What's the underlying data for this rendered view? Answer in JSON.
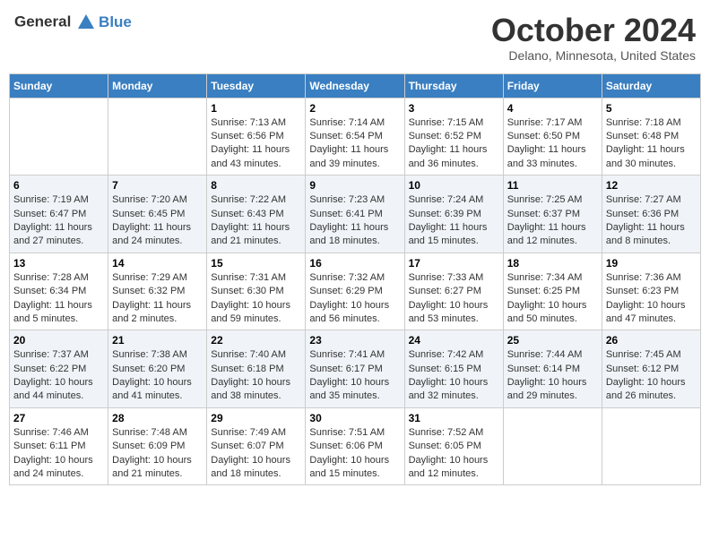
{
  "header": {
    "logo_line1": "General",
    "logo_line2": "Blue",
    "month": "October 2024",
    "location": "Delano, Minnesota, United States"
  },
  "weekdays": [
    "Sunday",
    "Monday",
    "Tuesday",
    "Wednesday",
    "Thursday",
    "Friday",
    "Saturday"
  ],
  "weeks": [
    [
      {
        "day": "",
        "sunrise": "",
        "sunset": "",
        "daylight": ""
      },
      {
        "day": "",
        "sunrise": "",
        "sunset": "",
        "daylight": ""
      },
      {
        "day": "1",
        "sunrise": "Sunrise: 7:13 AM",
        "sunset": "Sunset: 6:56 PM",
        "daylight": "Daylight: 11 hours and 43 minutes."
      },
      {
        "day": "2",
        "sunrise": "Sunrise: 7:14 AM",
        "sunset": "Sunset: 6:54 PM",
        "daylight": "Daylight: 11 hours and 39 minutes."
      },
      {
        "day": "3",
        "sunrise": "Sunrise: 7:15 AM",
        "sunset": "Sunset: 6:52 PM",
        "daylight": "Daylight: 11 hours and 36 minutes."
      },
      {
        "day": "4",
        "sunrise": "Sunrise: 7:17 AM",
        "sunset": "Sunset: 6:50 PM",
        "daylight": "Daylight: 11 hours and 33 minutes."
      },
      {
        "day": "5",
        "sunrise": "Sunrise: 7:18 AM",
        "sunset": "Sunset: 6:48 PM",
        "daylight": "Daylight: 11 hours and 30 minutes."
      }
    ],
    [
      {
        "day": "6",
        "sunrise": "Sunrise: 7:19 AM",
        "sunset": "Sunset: 6:47 PM",
        "daylight": "Daylight: 11 hours and 27 minutes."
      },
      {
        "day": "7",
        "sunrise": "Sunrise: 7:20 AM",
        "sunset": "Sunset: 6:45 PM",
        "daylight": "Daylight: 11 hours and 24 minutes."
      },
      {
        "day": "8",
        "sunrise": "Sunrise: 7:22 AM",
        "sunset": "Sunset: 6:43 PM",
        "daylight": "Daylight: 11 hours and 21 minutes."
      },
      {
        "day": "9",
        "sunrise": "Sunrise: 7:23 AM",
        "sunset": "Sunset: 6:41 PM",
        "daylight": "Daylight: 11 hours and 18 minutes."
      },
      {
        "day": "10",
        "sunrise": "Sunrise: 7:24 AM",
        "sunset": "Sunset: 6:39 PM",
        "daylight": "Daylight: 11 hours and 15 minutes."
      },
      {
        "day": "11",
        "sunrise": "Sunrise: 7:25 AM",
        "sunset": "Sunset: 6:37 PM",
        "daylight": "Daylight: 11 hours and 12 minutes."
      },
      {
        "day": "12",
        "sunrise": "Sunrise: 7:27 AM",
        "sunset": "Sunset: 6:36 PM",
        "daylight": "Daylight: 11 hours and 8 minutes."
      }
    ],
    [
      {
        "day": "13",
        "sunrise": "Sunrise: 7:28 AM",
        "sunset": "Sunset: 6:34 PM",
        "daylight": "Daylight: 11 hours and 5 minutes."
      },
      {
        "day": "14",
        "sunrise": "Sunrise: 7:29 AM",
        "sunset": "Sunset: 6:32 PM",
        "daylight": "Daylight: 11 hours and 2 minutes."
      },
      {
        "day": "15",
        "sunrise": "Sunrise: 7:31 AM",
        "sunset": "Sunset: 6:30 PM",
        "daylight": "Daylight: 10 hours and 59 minutes."
      },
      {
        "day": "16",
        "sunrise": "Sunrise: 7:32 AM",
        "sunset": "Sunset: 6:29 PM",
        "daylight": "Daylight: 10 hours and 56 minutes."
      },
      {
        "day": "17",
        "sunrise": "Sunrise: 7:33 AM",
        "sunset": "Sunset: 6:27 PM",
        "daylight": "Daylight: 10 hours and 53 minutes."
      },
      {
        "day": "18",
        "sunrise": "Sunrise: 7:34 AM",
        "sunset": "Sunset: 6:25 PM",
        "daylight": "Daylight: 10 hours and 50 minutes."
      },
      {
        "day": "19",
        "sunrise": "Sunrise: 7:36 AM",
        "sunset": "Sunset: 6:23 PM",
        "daylight": "Daylight: 10 hours and 47 minutes."
      }
    ],
    [
      {
        "day": "20",
        "sunrise": "Sunrise: 7:37 AM",
        "sunset": "Sunset: 6:22 PM",
        "daylight": "Daylight: 10 hours and 44 minutes."
      },
      {
        "day": "21",
        "sunrise": "Sunrise: 7:38 AM",
        "sunset": "Sunset: 6:20 PM",
        "daylight": "Daylight: 10 hours and 41 minutes."
      },
      {
        "day": "22",
        "sunrise": "Sunrise: 7:40 AM",
        "sunset": "Sunset: 6:18 PM",
        "daylight": "Daylight: 10 hours and 38 minutes."
      },
      {
        "day": "23",
        "sunrise": "Sunrise: 7:41 AM",
        "sunset": "Sunset: 6:17 PM",
        "daylight": "Daylight: 10 hours and 35 minutes."
      },
      {
        "day": "24",
        "sunrise": "Sunrise: 7:42 AM",
        "sunset": "Sunset: 6:15 PM",
        "daylight": "Daylight: 10 hours and 32 minutes."
      },
      {
        "day": "25",
        "sunrise": "Sunrise: 7:44 AM",
        "sunset": "Sunset: 6:14 PM",
        "daylight": "Daylight: 10 hours and 29 minutes."
      },
      {
        "day": "26",
        "sunrise": "Sunrise: 7:45 AM",
        "sunset": "Sunset: 6:12 PM",
        "daylight": "Daylight: 10 hours and 26 minutes."
      }
    ],
    [
      {
        "day": "27",
        "sunrise": "Sunrise: 7:46 AM",
        "sunset": "Sunset: 6:11 PM",
        "daylight": "Daylight: 10 hours and 24 minutes."
      },
      {
        "day": "28",
        "sunrise": "Sunrise: 7:48 AM",
        "sunset": "Sunset: 6:09 PM",
        "daylight": "Daylight: 10 hours and 21 minutes."
      },
      {
        "day": "29",
        "sunrise": "Sunrise: 7:49 AM",
        "sunset": "Sunset: 6:07 PM",
        "daylight": "Daylight: 10 hours and 18 minutes."
      },
      {
        "day": "30",
        "sunrise": "Sunrise: 7:51 AM",
        "sunset": "Sunset: 6:06 PM",
        "daylight": "Daylight: 10 hours and 15 minutes."
      },
      {
        "day": "31",
        "sunrise": "Sunrise: 7:52 AM",
        "sunset": "Sunset: 6:05 PM",
        "daylight": "Daylight: 10 hours and 12 minutes."
      },
      {
        "day": "",
        "sunrise": "",
        "sunset": "",
        "daylight": ""
      },
      {
        "day": "",
        "sunrise": "",
        "sunset": "",
        "daylight": ""
      }
    ]
  ]
}
